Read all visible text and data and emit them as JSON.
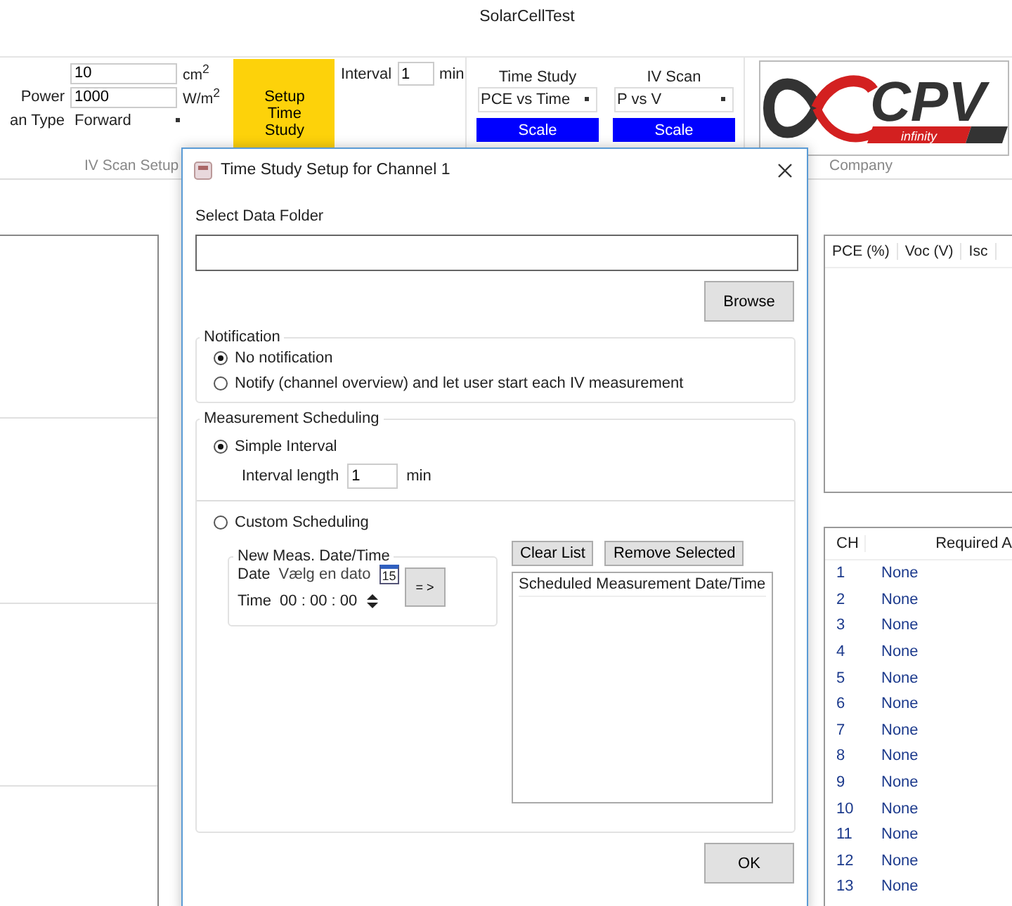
{
  "app": {
    "title": "SolarCellTest"
  },
  "ribbon": {
    "fields": [
      {
        "kind": "text",
        "value": "10",
        "unit": "cm$^{2}$"
      },
      {
        "kind": "text",
        "label": "Power",
        "value": "1000",
        "unit": "W/m$^{2}$"
      },
      {
        "kind": "dropdown",
        "label": "an Type",
        "value": "Forward"
      }
    ],
    "group_label": "IV Scan Setup",
    "setup_button": "Setup Time Study",
    "interval": {
      "label": "Interval",
      "value": "1",
      "unit": "min"
    },
    "plots": [
      {
        "label": "Time Study",
        "value": "PCE vs Time",
        "button": "Scale"
      },
      {
        "label": "IV Scan",
        "value": "P vs V",
        "button": "Scale"
      }
    ],
    "logo": {
      "text": "CPV",
      "subtext": "infinity"
    },
    "company_label": "Company"
  },
  "results_table": {
    "columns": [
      "PCE (%)",
      "Voc (V)",
      "Isc"
    ]
  },
  "channels_table": {
    "columns": [
      "CH",
      "Required A"
    ],
    "rows": [
      {
        "ch": "1",
        "value": "None"
      },
      {
        "ch": "2",
        "value": "None"
      },
      {
        "ch": "3",
        "value": "None"
      },
      {
        "ch": "4",
        "value": "None"
      },
      {
        "ch": "5",
        "value": "None"
      },
      {
        "ch": "6",
        "value": "None"
      },
      {
        "ch": "7",
        "value": "None"
      },
      {
        "ch": "8",
        "value": "None"
      },
      {
        "ch": "9",
        "value": "None"
      },
      {
        "ch": "10",
        "value": "None"
      },
      {
        "ch": "11",
        "value": "None"
      },
      {
        "ch": "12",
        "value": "None"
      },
      {
        "ch": "13",
        "value": "None"
      }
    ]
  },
  "dialog": {
    "title": "Time Study Setup for Channel 1",
    "folder_label": "Select Data Folder",
    "browse": "Browse",
    "notification": {
      "title": "Notification",
      "options": [
        {
          "label": "No notification",
          "selected": true
        },
        {
          "label": "Notify (channel overview) and let user start each IV measurement",
          "selected": false
        }
      ]
    },
    "scheduling": {
      "title": "Measurement Scheduling",
      "simple": {
        "label": "Simple Interval",
        "selected": true
      },
      "interval": {
        "label": "Interval length",
        "value": "1",
        "unit": "min"
      },
      "custom": {
        "label": "Custom Scheduling",
        "selected": false
      },
      "new_meas": {
        "title": "New Meas. Date/Time",
        "date_label": "Date",
        "date_placeholder": "Vælg en dato",
        "calendar_day": "15",
        "time_label": "Time",
        "time_value": "00 : 00 : 00",
        "add_button": "= >"
      },
      "clear_button": "Clear List",
      "remove_button": "Remove Selected",
      "list_header": "Scheduled Measurement Date/Time"
    },
    "ok": "OK"
  }
}
